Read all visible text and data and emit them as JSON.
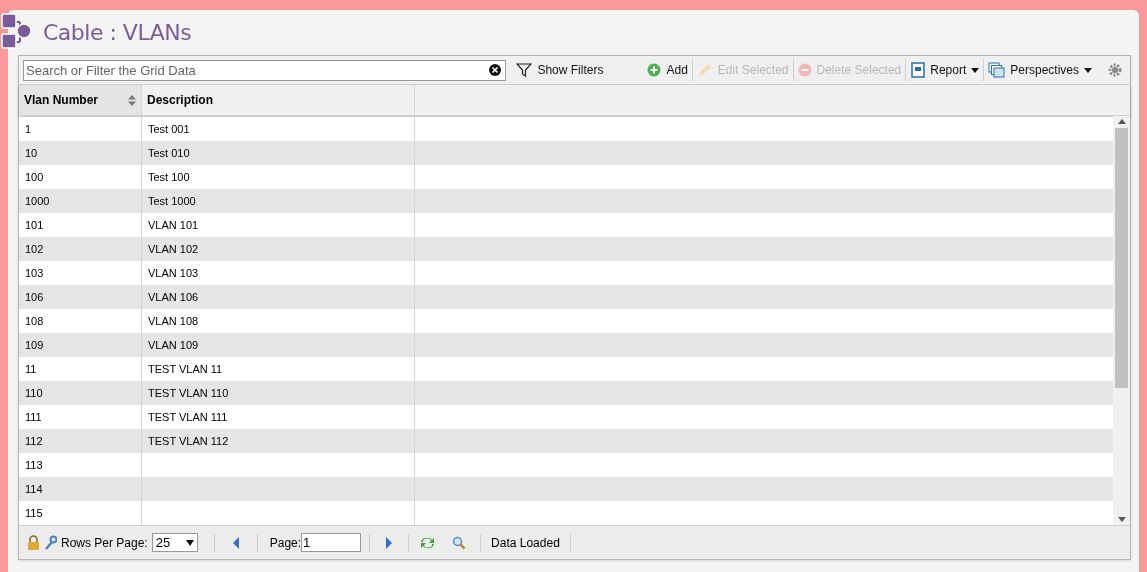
{
  "page": {
    "title": "Cable : VLANs"
  },
  "toolbar": {
    "search": {
      "placeholder": "Search or Filter the Grid Data"
    },
    "buttons": [
      {
        "kind": "filter",
        "label": "Show Filters",
        "disabled": false
      },
      {
        "kind": "add",
        "label": "Add",
        "disabled": false
      },
      {
        "kind": "edit",
        "label": "Edit Selected",
        "disabled": true
      },
      {
        "kind": "delete",
        "label": "Delete Selected",
        "disabled": true
      },
      {
        "kind": "report",
        "label": "Report",
        "disabled": false
      },
      {
        "kind": "perspectives",
        "label": "Perspectives",
        "disabled": false
      },
      {
        "kind": "settings"
      }
    ]
  },
  "table": {
    "columns": [
      "Vlan Number",
      "Description"
    ],
    "rows": [
      [
        "1",
        "Test 001"
      ],
      [
        "10",
        "Test 010"
      ],
      [
        "100",
        "Test 100"
      ],
      [
        "1000",
        "Test 1000"
      ],
      [
        "101",
        "VLAN 101"
      ],
      [
        "102",
        "VLAN 102"
      ],
      [
        "103",
        "VLAN 103"
      ],
      [
        "106",
        "VLAN 106"
      ],
      [
        "108",
        "VLAN 108"
      ],
      [
        "109",
        "VLAN 109"
      ],
      [
        "11",
        "TEST VLAN 11"
      ],
      [
        "110",
        "TEST VLAN 110"
      ],
      [
        "111",
        "TEST VLAN 111"
      ],
      [
        "112",
        "TEST VLAN 112"
      ],
      [
        "113",
        ""
      ],
      [
        "114",
        ""
      ],
      [
        "115",
        ""
      ]
    ]
  },
  "footer": {
    "rows_per_page_label": "Rows Per Page:",
    "rows_per_page": "25",
    "page_label": "Page:",
    "page": "1",
    "status": "Data Loaded"
  }
}
